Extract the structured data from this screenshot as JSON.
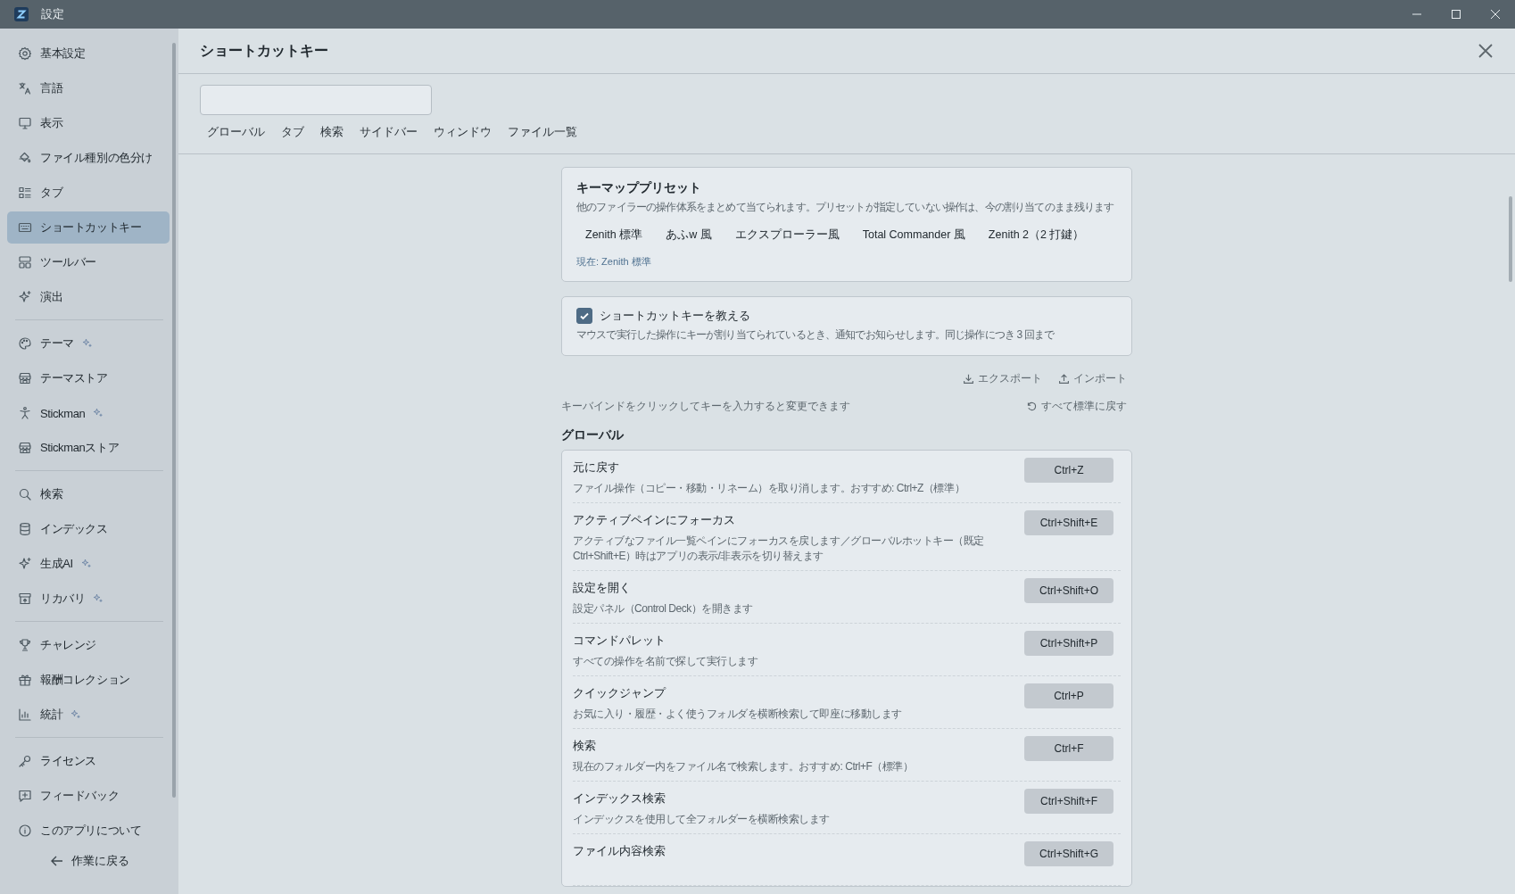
{
  "window": {
    "title": "設定"
  },
  "sidebar": {
    "groups": [
      {
        "items": [
          {
            "label": "基本設定",
            "selected": false,
            "sparkle": false
          },
          {
            "label": "言語",
            "selected": false,
            "sparkle": false
          },
          {
            "label": "表示",
            "selected": false,
            "sparkle": false
          },
          {
            "label": "ファイル種別の色分け",
            "selected": false,
            "sparkle": false
          },
          {
            "label": "タブ",
            "selected": false,
            "sparkle": false
          },
          {
            "label": "ショートカットキー",
            "selected": true,
            "sparkle": false
          },
          {
            "label": "ツールバー",
            "selected": false,
            "sparkle": false
          },
          {
            "label": "演出",
            "selected": false,
            "sparkle": false
          }
        ]
      },
      {
        "items": [
          {
            "label": "テーマ",
            "selected": false,
            "sparkle": true
          },
          {
            "label": "テーマストア",
            "selected": false,
            "sparkle": false
          },
          {
            "label": "Stickman",
            "selected": false,
            "sparkle": true
          },
          {
            "label": "Stickmanストア",
            "selected": false,
            "sparkle": false
          }
        ]
      },
      {
        "items": [
          {
            "label": "検索",
            "selected": false,
            "sparkle": false
          },
          {
            "label": "インデックス",
            "selected": false,
            "sparkle": false
          },
          {
            "label": "生成AI",
            "selected": false,
            "sparkle": true
          },
          {
            "label": "リカバリ",
            "selected": false,
            "sparkle": true
          }
        ]
      },
      {
        "items": [
          {
            "label": "チャレンジ",
            "selected": false,
            "sparkle": false
          },
          {
            "label": "報酬コレクション",
            "selected": false,
            "sparkle": false
          },
          {
            "label": "統計",
            "selected": false,
            "sparkle": true
          }
        ]
      },
      {
        "items": [
          {
            "label": "ライセンス",
            "selected": false,
            "sparkle": false
          },
          {
            "label": "フィードバック",
            "selected": false,
            "sparkle": false
          },
          {
            "label": "このアプリについて",
            "selected": false,
            "sparkle": false
          }
        ]
      }
    ],
    "back_link": "作業に戻る"
  },
  "page": {
    "title": "ショートカットキー",
    "tabs": [
      "グローバル",
      "タブ",
      "検索",
      "サイドバー",
      "ウィンドウ",
      "ファイル一覧"
    ],
    "preset_card": {
      "title": "キーマッププリセット",
      "description": "他のファイラーの操作体系をまとめて当てられます。プリセットが指定していない操作は、今の割り当てのまま残ります",
      "presets": [
        "Zenith 標準",
        "あふw 風",
        "エクスプローラー風",
        "Total Commander 風",
        "Zenith 2（2 打鍵）"
      ],
      "current": "現在: Zenith 標準"
    },
    "teach_card": {
      "label": "ショートカットキーを教える",
      "checked": true,
      "description": "マウスで実行した操作にキーが割り当てられているとき、通知でお知らせします。同じ操作につき 3 回まで"
    },
    "export_button": "エクスポート",
    "import_button": "インポート",
    "hint": "キーバインドをクリックしてキーを入力すると変更できます",
    "reset_button": "すべて標準に戻す",
    "section_title": "グローバル",
    "shortcuts": [
      {
        "name": "元に戻す",
        "description": "ファイル操作（コピー・移動・リネーム）を取り消します。おすすめ: Ctrl+Z（標準）",
        "key": "Ctrl+Z"
      },
      {
        "name": "アクティブペインにフォーカス",
        "description": "アクティブなファイル一覧ペインにフォーカスを戻します／グローバルホットキー（既定 Ctrl+Shift+E）時はアプリの表示/非表示を切り替えます",
        "key": "Ctrl+Shift+E"
      },
      {
        "name": "設定を開く",
        "description": "設定パネル（Control Deck）を開きます",
        "key": "Ctrl+Shift+O"
      },
      {
        "name": "コマンドパレット",
        "description": "すべての操作を名前で探して実行します",
        "key": "Ctrl+Shift+P"
      },
      {
        "name": "クイックジャンプ",
        "description": "お気に入り・履歴・よく使うフォルダを横断検索して即座に移動します",
        "key": "Ctrl+P"
      },
      {
        "name": "検索",
        "description": "現在のフォルダー内をファイル名で検索します。おすすめ: Ctrl+F（標準）",
        "key": "Ctrl+F"
      },
      {
        "name": "インデックス検索",
        "description": "インデックスを使用して全フォルダーを横断検索します",
        "key": "Ctrl+Shift+F"
      },
      {
        "name": "ファイル内容検索",
        "key": "Ctrl+Shift+G"
      }
    ]
  }
}
